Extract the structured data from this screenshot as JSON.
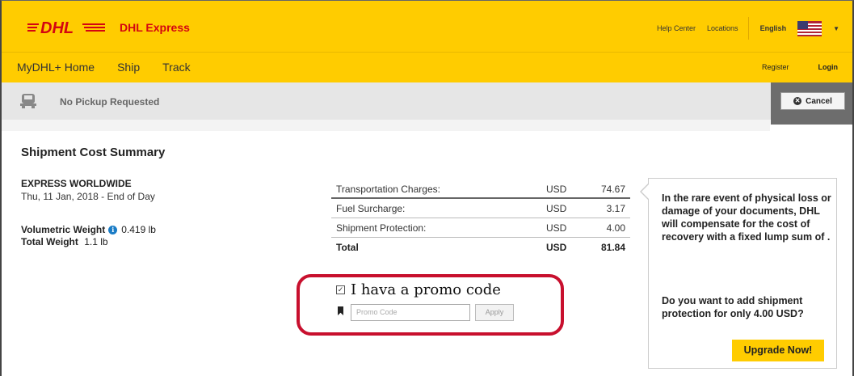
{
  "header": {
    "brand_name": "DHL Express",
    "logo_text": "DHL",
    "links": {
      "help_center": "Help Center",
      "locations": "Locations",
      "language": "English"
    }
  },
  "nav": {
    "home": "MyDHL+ Home",
    "ship": "Ship",
    "track": "Track",
    "register": "Register",
    "login": "Login"
  },
  "pickup": {
    "status": "No Pickup Requested",
    "cancel_label": "Cancel"
  },
  "summary": {
    "title": "Shipment Cost Summary",
    "service_name": "EXPRESS WORLDWIDE",
    "service_date": "Thu, 11 Jan, 2018 - End of Day",
    "volumetric_label": "Volumetric Weight",
    "volumetric_value": "0.419 lb",
    "total_weight_label": "Total Weight",
    "total_weight_value": "1.1 lb"
  },
  "charges": [
    {
      "label": "Transportation Charges:",
      "currency": "USD",
      "amount": "74.67"
    },
    {
      "label": "Fuel Surcharge:",
      "currency": "USD",
      "amount": "3.17"
    },
    {
      "label": "Shipment Protection:",
      "currency": "USD",
      "amount": "4.00"
    },
    {
      "label": "Total",
      "currency": "USD",
      "amount": "81.84"
    }
  ],
  "promo": {
    "checkbox_label": "I hava a promo code",
    "input_placeholder": "Promo Code",
    "apply_label": "Apply"
  },
  "protection": {
    "message": "In the rare event of physical loss or damage of your documents, DHL will compensate for the cost of recovery with a fixed lump sum of .",
    "question": "Do you want to add shipment protection for only 4.00 USD?",
    "upgrade_label": "Upgrade Now!"
  },
  "colors": {
    "dhl_yellow": "#ffcc00",
    "dhl_red": "#d40511",
    "highlight_red": "#c8102e",
    "info_blue": "#1a7cc6"
  }
}
